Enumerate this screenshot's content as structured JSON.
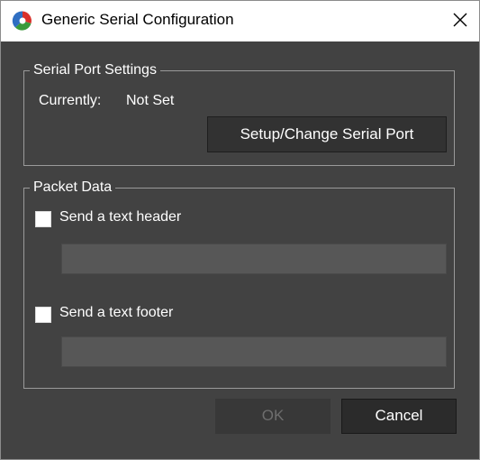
{
  "window": {
    "title": "Generic Serial Configuration",
    "icon": "app-logo-icon",
    "close_icon": "close-icon"
  },
  "serial_port_settings": {
    "legend": "Serial Port Settings",
    "currently_label": "Currently:",
    "currently_value": "Not Set",
    "setup_button_label": "Setup/Change Serial Port"
  },
  "packet_data": {
    "legend": "Packet Data",
    "header_checkbox_label": "Send a text header",
    "header_checked": false,
    "header_value": "",
    "footer_checkbox_label": "Send a text footer",
    "footer_checked": false,
    "footer_value": ""
  },
  "footer_buttons": {
    "ok_label": "OK",
    "ok_enabled": false,
    "cancel_label": "Cancel"
  },
  "colors": {
    "background": "#424242",
    "button": "#323232",
    "field": "#575757",
    "border": "#9a9a9a"
  }
}
